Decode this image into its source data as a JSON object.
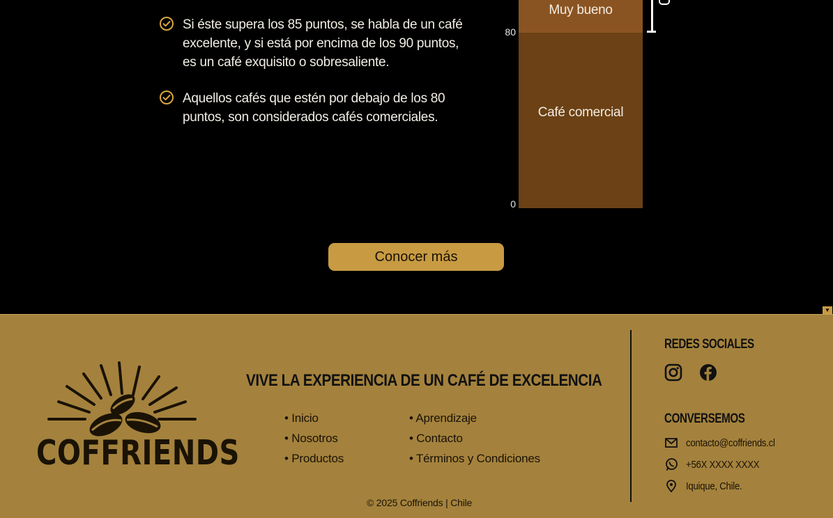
{
  "points": [
    "Si éste supera los 85 puntos, se habla de un café excelente, y si está por encima de los 90 puntos, es un café exquisito o sobresaliente.",
    "Aquellos cafés que estén por debajo de los 80 puntos, son considerados cafés comerciales."
  ],
  "chart_data": {
    "type": "bar",
    "segments": [
      {
        "label": "Café comercial",
        "from": 0,
        "to": 80,
        "color": "#6b4115"
      },
      {
        "label": "Muy bueno",
        "from": 80,
        "to": 85,
        "color": "#8a5422"
      }
    ],
    "ticks": [
      "0",
      "80"
    ]
  },
  "cta": {
    "label": "Conocer más"
  },
  "footer": {
    "logo_text": "COFFRIENDS",
    "tagline": "VIVE LA EXPERIENCIA DE UN CAFÉ DE EXCELENCIA",
    "nav_col1": [
      "• Inicio",
      "• Nosotros",
      "• Productos"
    ],
    "nav_col2": [
      "• Aprendizaje",
      "• Contacto",
      "• Términos y Condiciones"
    ],
    "copyright": "© 2025 Coffriends | Chile",
    "social_title": "REDES SOCIALES",
    "contact_title": "CONVERSEMOS",
    "email": "contacto@coffriends.cl",
    "phone": "+56X XXXX XXXX",
    "location": "Iquique, Chile."
  },
  "colors": {
    "accent": "#c89b42",
    "footer_bg": "#a4823d",
    "bar_dark": "#6b4115",
    "bar_light": "#8a5422"
  }
}
